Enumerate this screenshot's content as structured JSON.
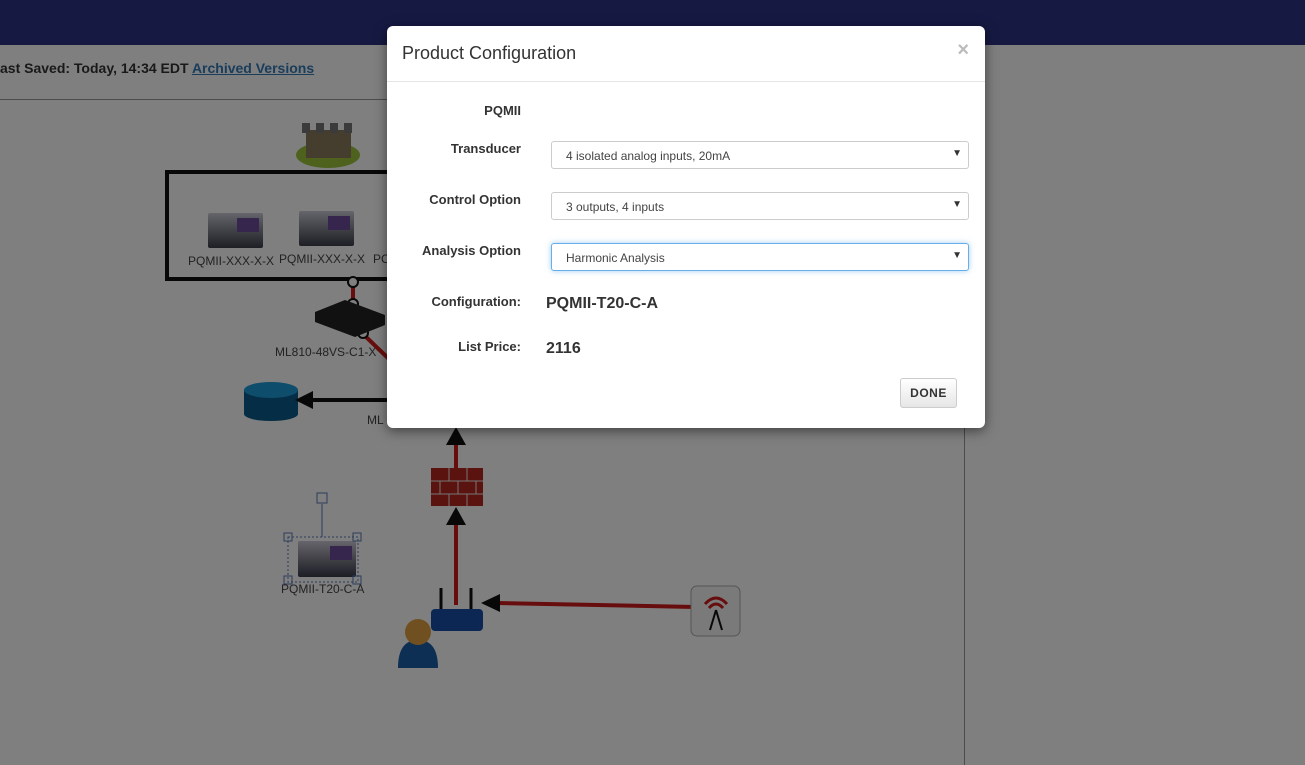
{
  "header": {
    "save_prefix": "ast Saved: Today, 14:34 EDT",
    "archived_link": "Archived Versions"
  },
  "diagram": {
    "device_labels": [
      "PQMII-XXX-X-X",
      "PQMII-XXX-X-X",
      "PC"
    ],
    "switch_label": "ML810-48VS-C1-X",
    "ml_label": "ML",
    "selected_device_label": "PQMII-T20-C-A",
    "icons": [
      "factory-icon",
      "relay-device-icon",
      "switch-icon",
      "database-icon",
      "firewall-icon",
      "router-icon",
      "user-icon",
      "radio-tower-icon"
    ],
    "link_color": "#d11a1a"
  },
  "modal": {
    "title": "Product Configuration",
    "close_label": "×",
    "product_label": "PQMII",
    "fields": [
      {
        "label": "Transducer",
        "value": "4 isolated analog inputs, 20mA"
      },
      {
        "label": "Control Option",
        "value": "3 outputs, 4 inputs"
      },
      {
        "label": "Analysis Option",
        "value": "Harmonic Analysis"
      }
    ],
    "configuration_label": "Configuration:",
    "configuration_value": "PQMII-T20-C-A",
    "list_price_label": "List Price:",
    "list_price_value": "2116",
    "done_label": "DONE"
  }
}
